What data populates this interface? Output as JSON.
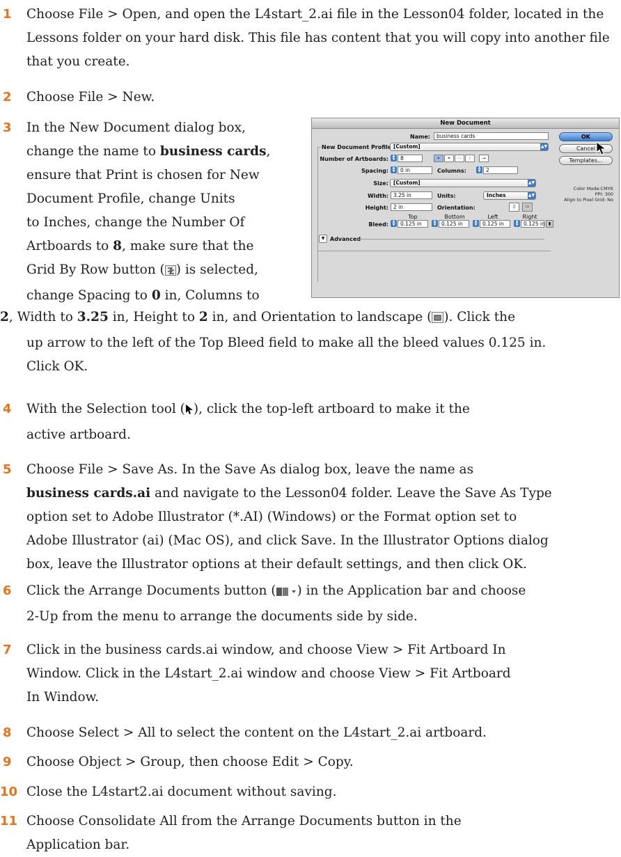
{
  "steps": [
    {
      "num": "1",
      "t1": "Choose File > Open, and open the L4start_2.ai file in the Lesson04 folder, located in the Lessons folder on your hard disk. This file has content that you will copy into another file that you create."
    },
    {
      "num": "2",
      "t1": "Choose File > New."
    },
    {
      "num": "3",
      "l1": "In the New Document dialog box,",
      "l2a": "change the name to ",
      "l2b": "business cards",
      "l2c": ",",
      "l3": "ensure that Print is chosen for New",
      "l4": "Document Profile, change Units",
      "l5": "to Inches, change the Number Of",
      "l6a": "Artboards to ",
      "l6b": "8",
      "l6c": ", make sure that the",
      "l7a": "Grid By Row button (",
      "l7c": ") is selected,",
      "l8a": "change Spacing to ",
      "l8b": "0",
      "l8c": " in, Columns to",
      "l9a": "2",
      "l9b": ", Width to ",
      "l9c": "3.25",
      "l9d": " in, Height to ",
      "l9e": "2",
      "l9f": " in, and Orientation to landscape (",
      "l9g": "). Click the",
      "l10": "up arrow to the left of the Top Bleed field to make all the bleed values 0.125 in.",
      "l11": "Click OK."
    },
    {
      "num": "4",
      "a": "With the Selection tool (",
      "b": "), click the top-left artboard to make it the",
      "c": "active artboard."
    },
    {
      "num": "5",
      "a": "Choose File > Save As. In the Save As dialog box, leave the name as",
      "b": "business cards.ai",
      "c": " and navigate to the Lesson04 folder. Leave the Save As Type",
      "d": "option set to Adobe Illustrator (*.AI) (Windows) or the Format option set to",
      "e": "Adobe Illustrator (ai) (Mac OS), and click Save. In the Illustrator Options dialog",
      "f": "box, leave the Illustrator options at their default settings, and then click OK."
    },
    {
      "num": "6",
      "a": "Click the Arrange Documents button (",
      "b": ") in the Application bar and choose",
      "c": "2-Up from the menu to arrange the documents side by side."
    },
    {
      "num": "7",
      "a": "Click in the business cards.ai window, and choose View > Fit Artboard In",
      "b": "Window. Click in the L4start_2.ai window and choose View > Fit Artboard",
      "c": "In Window."
    },
    {
      "num": "8",
      "a": "Choose Select > All to select the content on the L4start_2.ai artboard."
    },
    {
      "num": "9",
      "a": "Choose Object > Group, then choose Edit > Copy."
    },
    {
      "num": "10",
      "a": "Close the L4start2.ai document without saving."
    },
    {
      "num": "11",
      "a": "Choose Consolidate All from the Arrange Documents button in the",
      "b": "Application bar."
    }
  ],
  "dialog": {
    "title": "New Document",
    "name_label": "Name:",
    "name_value": "business cards",
    "profile_label": "New Document Profile:",
    "profile_value": "[Custom]",
    "artboards_label": "Number of Artboards:",
    "artboards_value": "8",
    "spacing_label": "Spacing:",
    "spacing_value": "0 in",
    "columns_label": "Columns:",
    "columns_value": "2",
    "size_label": "Size:",
    "size_value": "[Custom]",
    "width_label": "Width:",
    "width_value": "3.25 in",
    "units_label": "Units:",
    "units_value": "Inches",
    "height_label": "Height:",
    "height_value": "2 in",
    "orientation_label": "Orientation:",
    "bleed_label": "Bleed:",
    "bleed_top_label": "Top",
    "bleed_bottom_label": "Bottom",
    "bleed_left_label": "Left",
    "bleed_right_label": "Right",
    "bleed_top": "0.125 in",
    "bleed_bottom": "0.125 in",
    "bleed_left": "0.125 in",
    "bleed_right": "0.125 in",
    "advanced_label": "Advanced",
    "ok_label": "OK",
    "cancel_label": "Cancel",
    "templates_label": "Templates...",
    "info_color": "Color Mode:CMYK",
    "info_ppi": "PPI: 300",
    "info_align": "Align to Pixel Grid: No"
  },
  "colors": {
    "step_number": "#e8731b",
    "accent_blue": "#3d7ac6"
  }
}
